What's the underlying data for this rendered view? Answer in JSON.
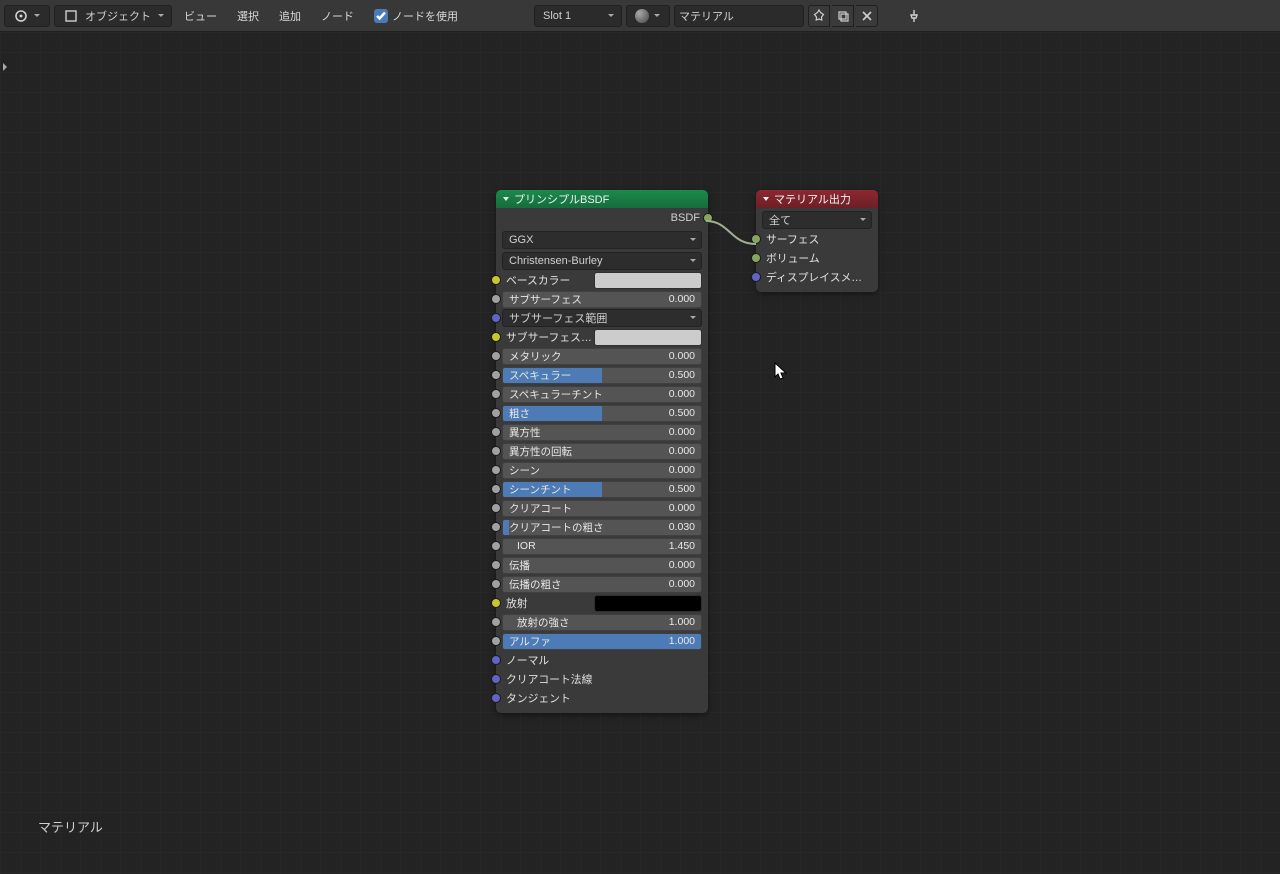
{
  "header": {
    "mode_label": "オブジェクト",
    "menus": [
      "ビュー",
      "選択",
      "追加",
      "ノード"
    ],
    "use_nodes_label": "ノードを使用",
    "slot_label": "Slot 1",
    "material_label": "マテリアル"
  },
  "bottom_label": "マテリアル",
  "bsdf": {
    "title": "プリンシプルBSDF",
    "output": "BSDF",
    "distribution": "GGX",
    "sss_method": "Christensen-Burley",
    "rows": {
      "base_color": "ベースカラー",
      "subsurface": {
        "label": "サブサーフェス",
        "value": "0.000",
        "pct": 0
      },
      "subsurface_radius": "サブサーフェス範囲",
      "subsurface_color": "サブサーフェスカ...",
      "metallic": {
        "label": "メタリック",
        "value": "0.000",
        "pct": 0
      },
      "specular": {
        "label": "スペキュラー",
        "value": "0.500",
        "pct": 50
      },
      "specular_tint": {
        "label": "スペキュラーチント",
        "value": "0.000",
        "pct": 0
      },
      "roughness": {
        "label": "粗さ",
        "value": "0.500",
        "pct": 50
      },
      "anisotropic": {
        "label": "異方性",
        "value": "0.000",
        "pct": 0
      },
      "anisotropic_rot": {
        "label": "異方性の回転",
        "value": "0.000",
        "pct": 0
      },
      "sheen": {
        "label": "シーン",
        "value": "0.000",
        "pct": 0
      },
      "sheen_tint": {
        "label": "シーンチント",
        "value": "0.500",
        "pct": 50
      },
      "clearcoat": {
        "label": "クリアコート",
        "value": "0.000",
        "pct": 0
      },
      "clearcoat_rough": {
        "label": "クリアコートの粗さ",
        "value": "0.030",
        "pct": 3
      },
      "ior": {
        "label": "IOR",
        "value": "1.450"
      },
      "transmission": {
        "label": "伝播",
        "value": "0.000",
        "pct": 0
      },
      "transmission_rough": {
        "label": "伝播の粗さ",
        "value": "0.000",
        "pct": 0
      },
      "emission": "放射",
      "emission_strength": {
        "label": "放射の強さ",
        "value": "1.000"
      },
      "alpha": {
        "label": "アルファ",
        "value": "1.000",
        "pct": 100
      },
      "normal": "ノーマル",
      "clearcoat_normal": "クリアコート法線",
      "tangent": "タンジェント"
    }
  },
  "output": {
    "title": "マテリアル出力",
    "target": "全て",
    "inputs": {
      "surface": "サーフェス",
      "volume": "ボリューム",
      "displacement": "ディスプレイスメント"
    }
  }
}
